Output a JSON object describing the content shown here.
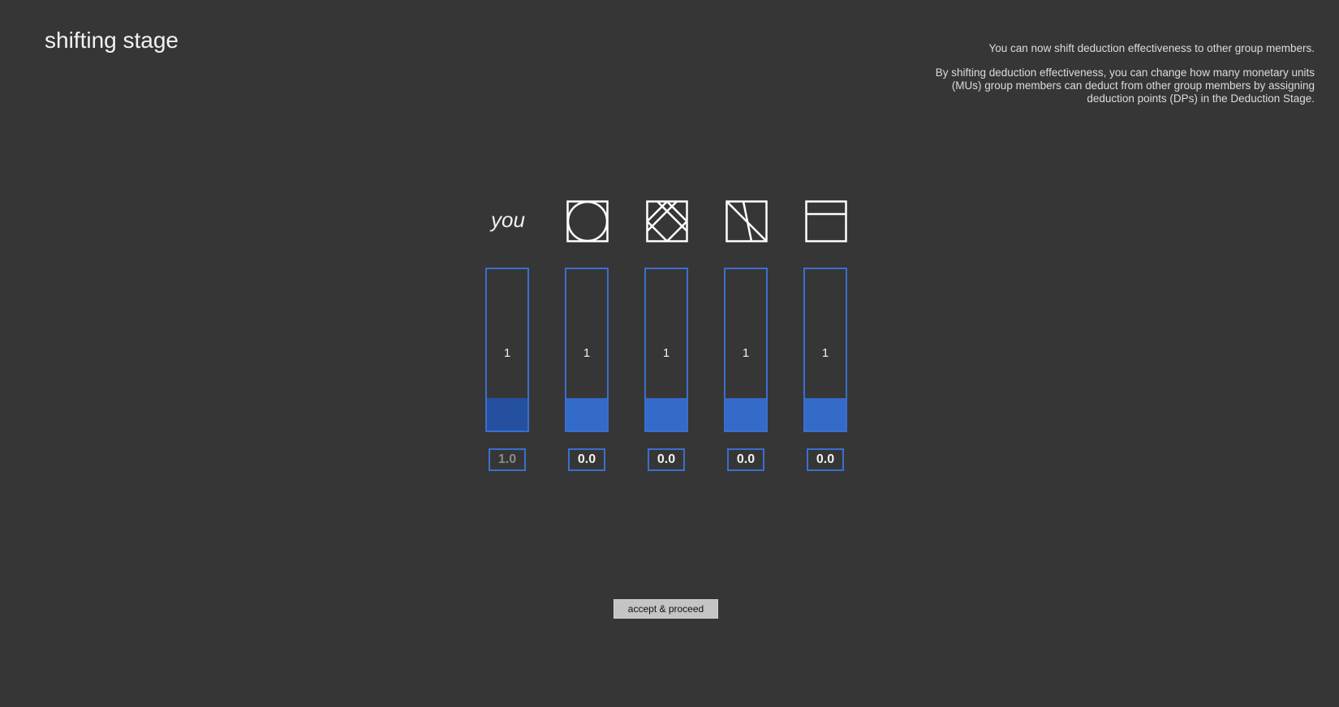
{
  "page": {
    "title": "shifting stage"
  },
  "instructions": {
    "line1": "You can now shift deduction effectiveness to other group members.",
    "line2": "By shifting deduction effectiveness, you can change how many monetary units (MUs) group members can deduct from other group members by assigning deduction points (DPs) in the Deduction Stage."
  },
  "members": [
    {
      "label": "you",
      "icon": "you-label",
      "bar_value": "1",
      "fill_fraction": 0.2,
      "input_value": "1.0",
      "input_enabled": false
    },
    {
      "label": "",
      "icon": "circle-symbol-icon",
      "bar_value": "1",
      "fill_fraction": 0.2,
      "input_value": "0.0",
      "input_enabled": true
    },
    {
      "label": "",
      "icon": "diamond-cross-symbol-icon",
      "bar_value": "1",
      "fill_fraction": 0.2,
      "input_value": "0.0",
      "input_enabled": true
    },
    {
      "label": "",
      "icon": "diagonal-lines-symbol-icon",
      "bar_value": "1",
      "fill_fraction": 0.2,
      "input_value": "0.0",
      "input_enabled": true
    },
    {
      "label": "",
      "icon": "horizontal-line-symbol-icon",
      "bar_value": "1",
      "fill_fraction": 0.2,
      "input_value": "0.0",
      "input_enabled": true
    }
  ],
  "colors": {
    "background": "#363636",
    "accent": "#346ac8",
    "self_fill": "#24509f",
    "button": "#c4c4c4"
  },
  "actions": {
    "accept_label": "accept & proceed"
  }
}
